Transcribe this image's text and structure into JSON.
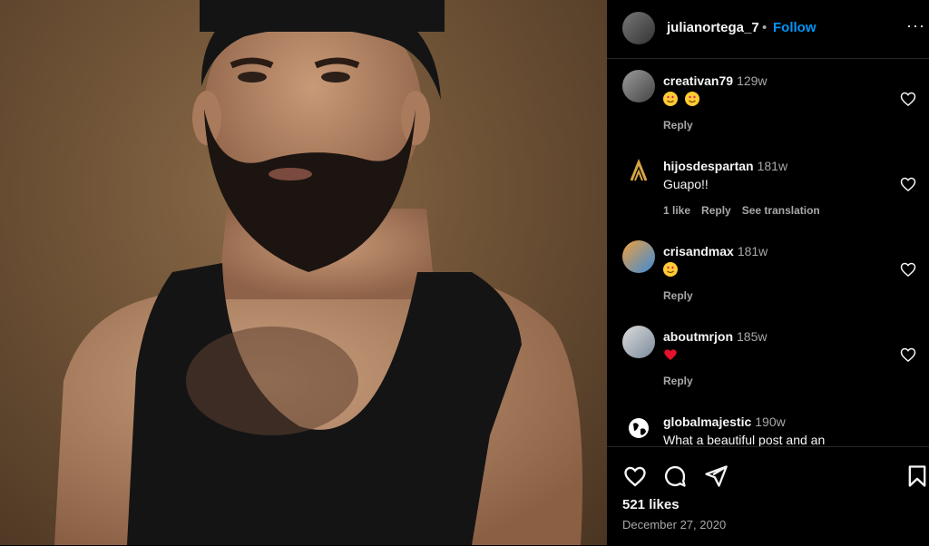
{
  "post": {
    "username": "julianortega_7",
    "separator": "•",
    "follow_label": "Follow",
    "more_label": "···",
    "likes": "521 likes",
    "date": "December 27, 2020"
  },
  "comments": [
    {
      "username": "creativan79",
      "time": "129w",
      "text": "",
      "emojis": [
        "heart-eyes-emoji",
        "heart-eyes-emoji"
      ],
      "meta": [
        "Reply"
      ]
    },
    {
      "username": "hijosdespartan",
      "time": "181w",
      "text": "Guapo!!",
      "emojis": [],
      "meta": [
        "1 like",
        "Reply",
        "See translation"
      ]
    },
    {
      "username": "crisandmax",
      "time": "181w",
      "text": "",
      "emojis": [
        "heart-eyes-emoji"
      ],
      "meta": [
        "Reply"
      ]
    },
    {
      "username": "aboutmrjon",
      "time": "185w",
      "text": "",
      "emojis": [
        "red-heart-emoji"
      ],
      "meta": [
        "Reply"
      ]
    },
    {
      "username": "globalmajestic",
      "time": "190w",
      "text": "What a beautiful post and an",
      "emojis": [],
      "meta": []
    }
  ],
  "colors": {
    "accent": "#0095f6",
    "background": "#000000",
    "secondary_text": "#a8a8a8",
    "heart": "#ed4956"
  }
}
